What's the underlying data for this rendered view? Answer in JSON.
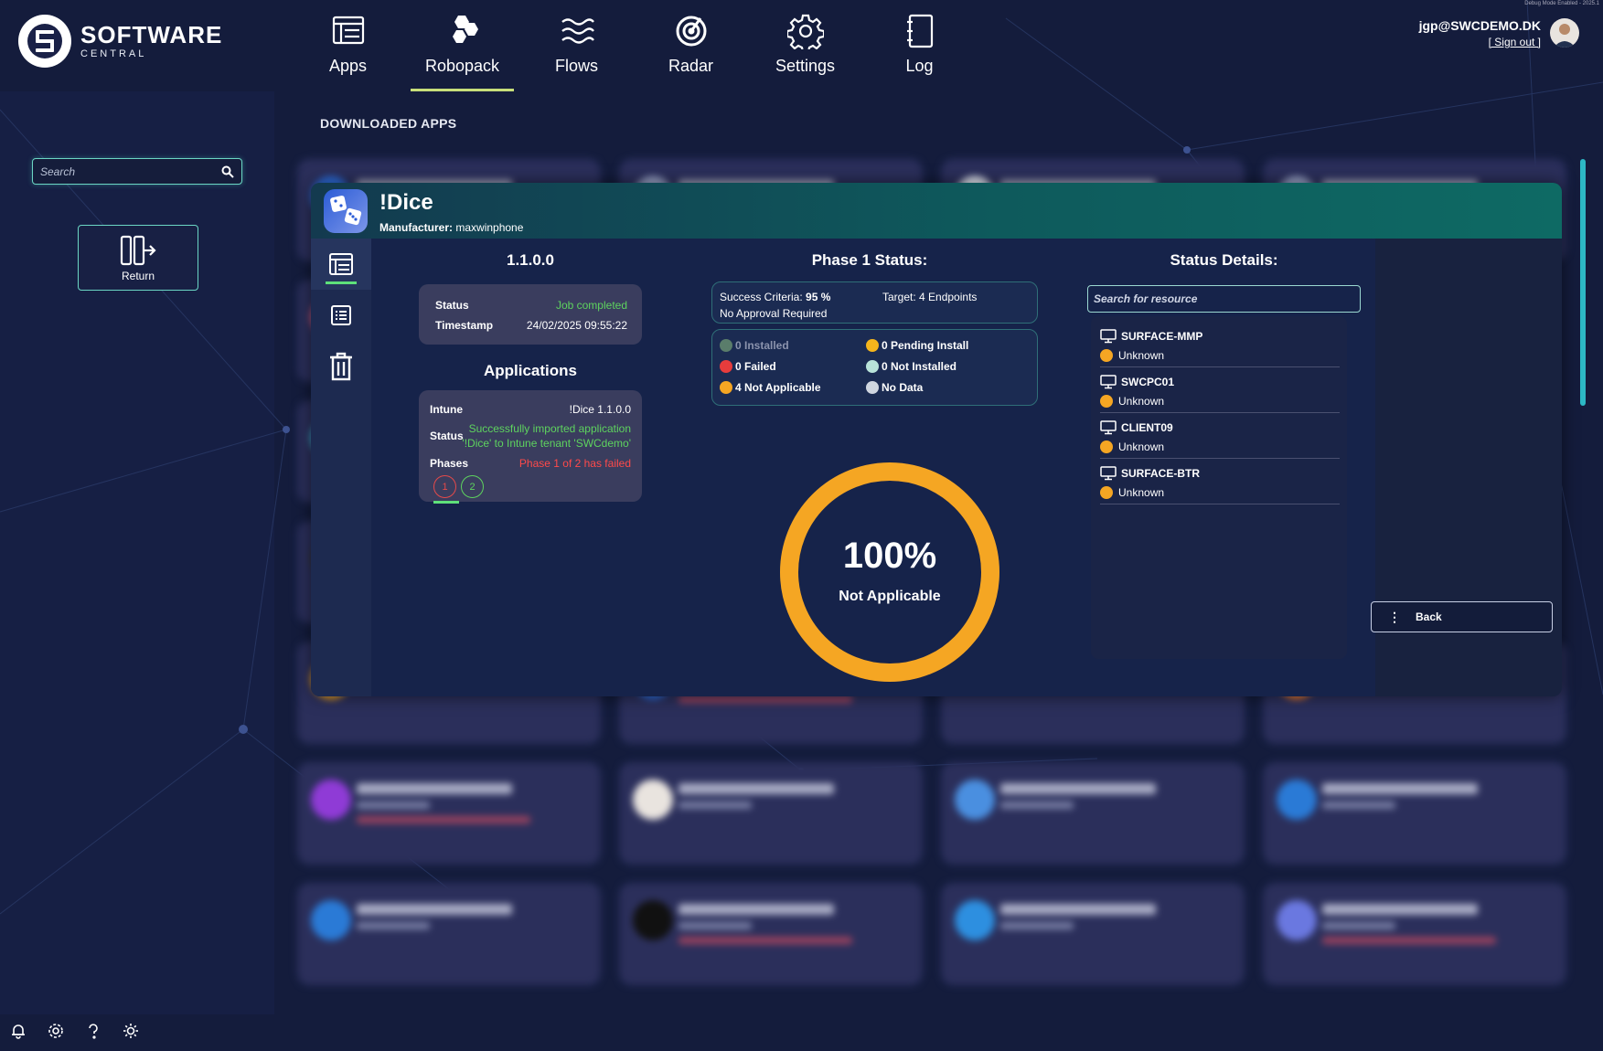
{
  "debug_text": "Debug Mode Enabled - 2025.1",
  "brand": {
    "name": "SOFTWARE",
    "sub": "CENTRAL"
  },
  "nav": [
    {
      "label": "Apps",
      "icon": "apps-icon"
    },
    {
      "label": "Robopack",
      "icon": "robopack-icon",
      "active": true
    },
    {
      "label": "Flows",
      "icon": "flows-icon"
    },
    {
      "label": "Radar",
      "icon": "radar-icon"
    },
    {
      "label": "Settings",
      "icon": "settings-icon"
    },
    {
      "label": "Log",
      "icon": "log-icon"
    }
  ],
  "user": {
    "email": "jgp@SWCDEMO.DK",
    "signout": "[ Sign out ]"
  },
  "sidebar": {
    "search_placeholder": "Search",
    "return_label": "Return"
  },
  "main": {
    "section_title": "DOWNLOADED APPS"
  },
  "modal": {
    "app_name": "!Dice",
    "manufacturer_label": "Manufacturer:",
    "manufacturer": "maxwinphone",
    "version": "1.1.0.0",
    "job": {
      "status_label": "Status",
      "status_value": "Job completed",
      "timestamp_label": "Timestamp",
      "timestamp_value": "24/02/2025 09:55:22"
    },
    "applications": {
      "title": "Applications",
      "intune_label": "Intune",
      "intune_value": "!Dice 1.1.0.0",
      "status_label": "Status",
      "status_line1": "Successfully imported application",
      "status_line2": "'!Dice' to Intune tenant 'SWCdemo'",
      "phases_label": "Phases",
      "phases_value": "Phase 1 of 2 has failed",
      "phase_1": "1",
      "phase_2": "2"
    },
    "phase_status": {
      "title": "Phase 1 Status:",
      "success_label": "Success Criteria:",
      "success_value": "95 %",
      "target": "Target: 4 Endpoints",
      "approval": "No Approval Required",
      "legend": [
        {
          "label": "0 Installed",
          "color": "#5a7d6b",
          "dim": true
        },
        {
          "label": "0 Pending Install",
          "color": "#f5b51c"
        },
        {
          "label": "0 Failed",
          "color": "#e73c3c"
        },
        {
          "label": "0 Not Installed",
          "color": "#b9e3d9"
        },
        {
          "label": "4 Not Applicable",
          "color": "#f5a623"
        },
        {
          "label": "No Data",
          "color": "#cfd6e0"
        }
      ],
      "donut_percent": "100%",
      "donut_label": "Not Applicable",
      "donut_fraction": 1.0,
      "donut_color": "#f5a623"
    },
    "status_details": {
      "title": "Status Details:",
      "search_placeholder": "Search for resource",
      "resources": [
        {
          "name": "SURFACE-MMP",
          "status": "Unknown"
        },
        {
          "name": "SWCPC01",
          "status": "Unknown"
        },
        {
          "name": "CLIENT09",
          "status": "Unknown"
        },
        {
          "name": "SURFACE-BTR",
          "status": "Unknown"
        }
      ]
    },
    "back_label": "Back"
  },
  "colors": {
    "accent_teal": "#6bd6c4",
    "unknown_orange": "#f5a623",
    "success_green": "#5ed35e",
    "fail_red": "#ff4a4a"
  }
}
